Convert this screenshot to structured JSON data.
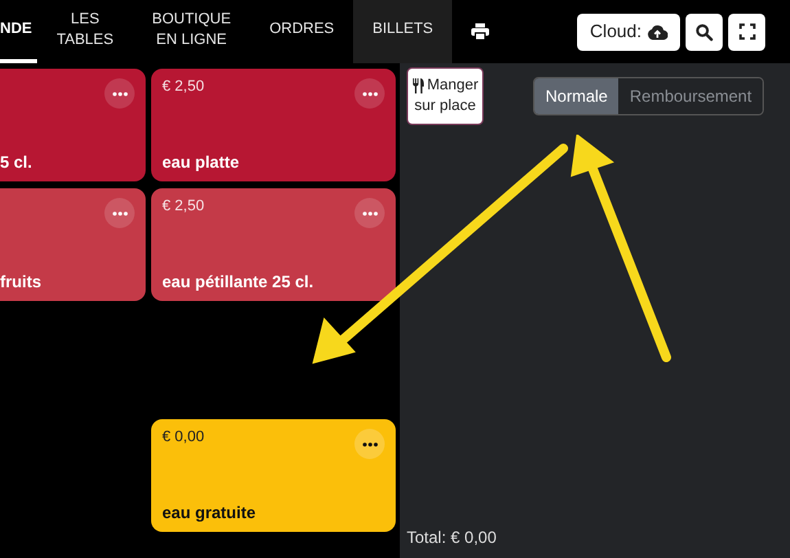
{
  "tabs": [
    {
      "lines": [
        "NDE"
      ],
      "selected": true,
      "highlighted": false
    },
    {
      "lines": [
        "LES",
        "TABLES"
      ],
      "selected": false,
      "highlighted": false
    },
    {
      "lines": [
        "BOUTIQUE",
        "EN LIGNE"
      ],
      "selected": false,
      "highlighted": false
    },
    {
      "lines": [
        "ORDRES"
      ],
      "selected": false,
      "highlighted": false
    },
    {
      "lines": [
        "BILLETS"
      ],
      "selected": false,
      "highlighted": true
    }
  ],
  "toolbar": {
    "cloud_label": "Cloud:"
  },
  "product_rows": [
    {
      "cells": [
        {
          "kind": "product",
          "name": "5 cl.",
          "color": "#b71733"
        },
        {
          "kind": "product",
          "price": "€ 2,50",
          "name": "eau platte",
          "color": "#b71733"
        }
      ]
    },
    {
      "cells": [
        {
          "kind": "product",
          "name": "fruits",
          "color": "#c43a48"
        },
        {
          "kind": "product",
          "price": "€ 2,50",
          "name": "eau pétillante 25 cl.",
          "color": "#c43a48"
        }
      ]
    },
    {
      "cells": [
        {
          "kind": "empty"
        },
        {
          "kind": "product",
          "price": "€ 0,00",
          "name": "eau gratuite",
          "color": "#fbbf0a"
        }
      ]
    }
  ],
  "order": {
    "dine_button": {
      "lines": [
        "Manger",
        "sur place"
      ]
    },
    "modes": [
      {
        "label": "Normale",
        "selected": true
      },
      {
        "label": "Remboursement",
        "selected": false
      }
    ],
    "total": "Total: € 0,00"
  }
}
